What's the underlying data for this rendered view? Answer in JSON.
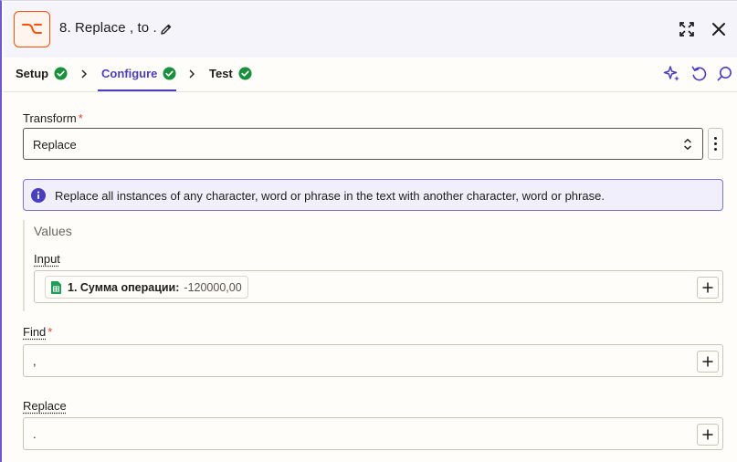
{
  "header": {
    "title": "8. Replace , to .",
    "app_icon": "formatter-icon",
    "accent": "#ff4f00"
  },
  "tabs": [
    {
      "label": "Setup",
      "status": "complete"
    },
    {
      "label": "Configure",
      "status": "complete",
      "active": true
    },
    {
      "label": "Test",
      "status": "complete"
    }
  ],
  "form": {
    "transform": {
      "label": "Transform",
      "required": true,
      "value": "Replace"
    },
    "info_text": "Replace all instances of any character, word or phrase in the text with another character, word or phrase.",
    "values_title": "Values",
    "input": {
      "label": "Input",
      "pill_label": "1. Сумма операции:",
      "pill_value": "-120000,00"
    },
    "find": {
      "label": "Find",
      "required": true,
      "value": ","
    },
    "replace": {
      "label": "Replace",
      "value": "."
    }
  },
  "colors": {
    "brand": "#4a3fbf",
    "check": "#1a8f3c",
    "required": "#e8412c",
    "info_bg": "#f1effc"
  }
}
